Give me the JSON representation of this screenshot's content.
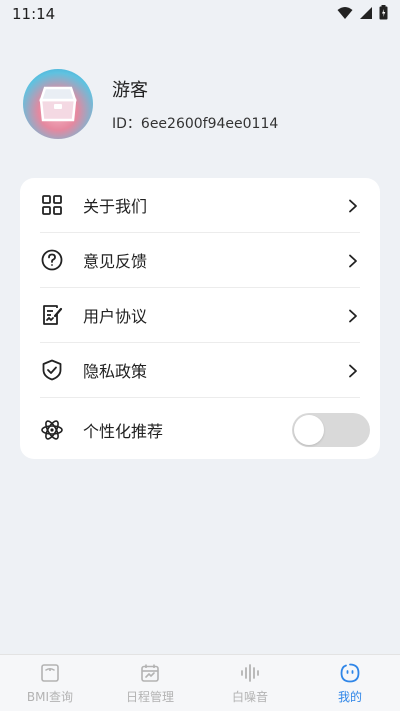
{
  "status_bar": {
    "time": "11:14"
  },
  "profile": {
    "username": "游客",
    "user_id": "ID：6ee2600f94ee0114"
  },
  "menu": {
    "items": [
      {
        "label": "关于我们",
        "icon": "grid-icon"
      },
      {
        "label": "意见反馈",
        "icon": "question-circle-icon"
      },
      {
        "label": "用户协议",
        "icon": "document-edit-icon"
      },
      {
        "label": "隐私政策",
        "icon": "shield-check-icon"
      }
    ],
    "personalized": {
      "label": "个性化推荐",
      "icon": "atom-icon",
      "enabled": false
    }
  },
  "tab_bar": {
    "tabs": [
      {
        "label": "BMI查询",
        "icon": "scale-icon",
        "active": false
      },
      {
        "label": "日程管理",
        "icon": "calendar-icon",
        "active": false
      },
      {
        "label": "白噪音",
        "icon": "waveform-icon",
        "active": false
      },
      {
        "label": "我的",
        "icon": "smiley-icon",
        "active": true
      }
    ],
    "active_color": "#2f86e8",
    "inactive_color": "#b3b3b3"
  }
}
